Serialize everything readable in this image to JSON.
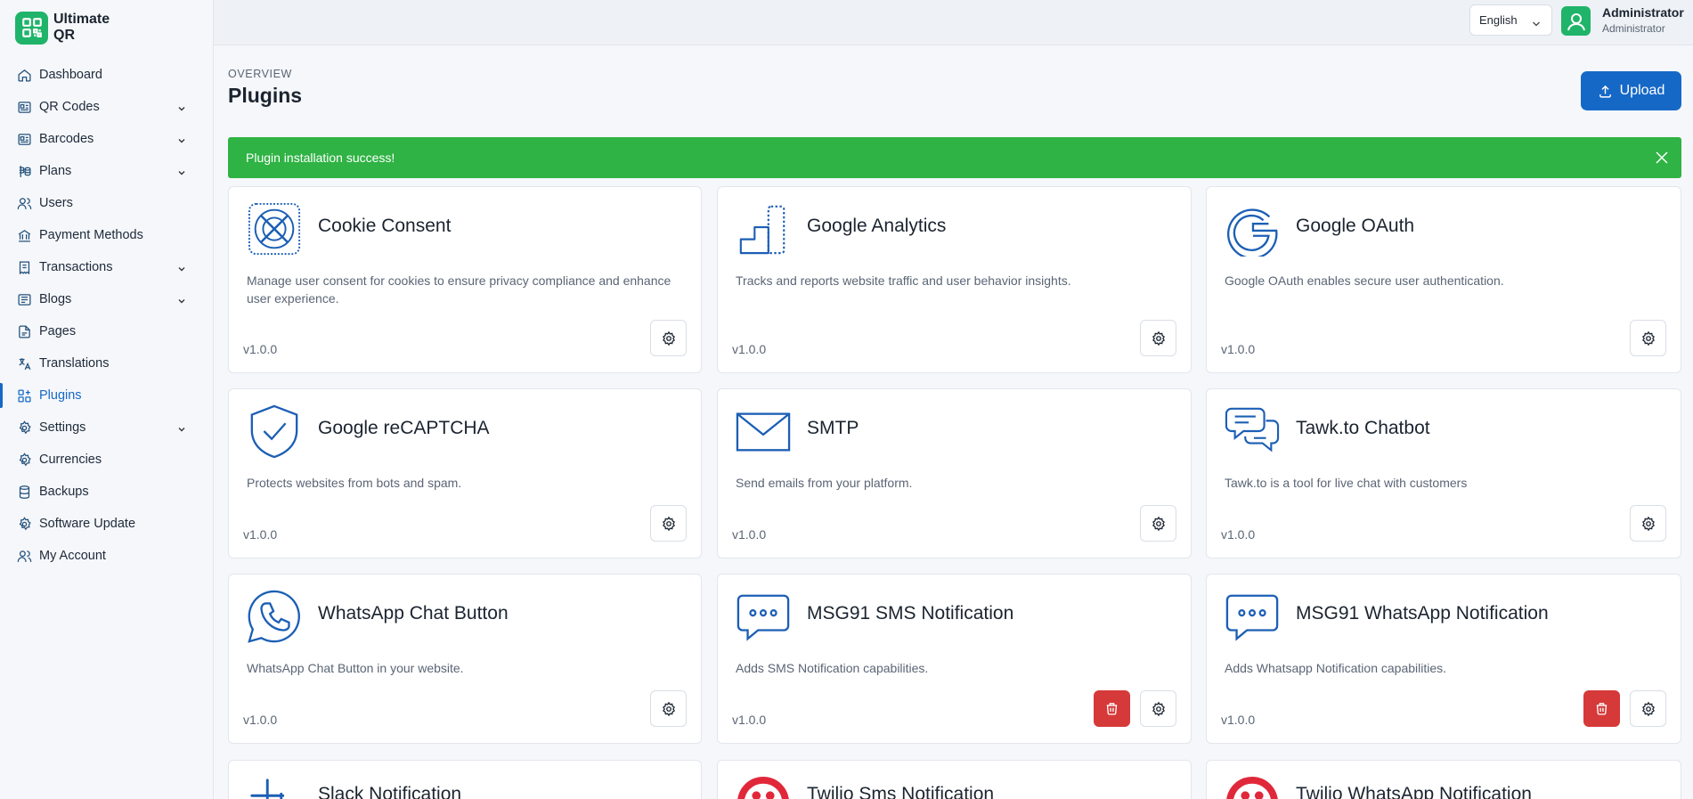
{
  "brand": {
    "name": "Ultimate QR"
  },
  "sidebar": {
    "items": [
      {
        "label": "Dashboard"
      },
      {
        "label": "QR Codes"
      },
      {
        "label": "Barcodes"
      },
      {
        "label": "Plans"
      },
      {
        "label": "Users"
      },
      {
        "label": "Payment Methods"
      },
      {
        "label": "Transactions"
      },
      {
        "label": "Blogs"
      },
      {
        "label": "Pages"
      },
      {
        "label": "Translations"
      },
      {
        "label": "Plugins"
      },
      {
        "label": "Settings"
      },
      {
        "label": "Currencies"
      },
      {
        "label": "Backups"
      },
      {
        "label": "Software Update"
      },
      {
        "label": "My Account"
      }
    ]
  },
  "topbar": {
    "language": "English",
    "user_name": "Administrator",
    "user_role": "Administrator"
  },
  "header": {
    "overline": "OVERVIEW",
    "title": "Plugins",
    "upload_label": "Upload"
  },
  "alert": {
    "message": "Plugin installation success!"
  },
  "plugins": [
    {
      "title": "Cookie Consent",
      "desc": "Manage user consent for cookies to ensure privacy compliance and enhance user experience.",
      "version": "v1.0.0"
    },
    {
      "title": "Google Analytics",
      "desc": "Tracks and reports website traffic and user behavior insights.",
      "version": "v1.0.0"
    },
    {
      "title": "Google OAuth",
      "desc": "Google OAuth enables secure user authentication.",
      "version": "v1.0.0"
    },
    {
      "title": "Google reCAPTCHA",
      "desc": "Protects websites from bots and spam.",
      "version": "v1.0.0"
    },
    {
      "title": "SMTP",
      "desc": "Send emails from your platform.",
      "version": "v1.0.0"
    },
    {
      "title": "Tawk.to Chatbot",
      "desc": "Tawk.to is a tool for live chat with customers",
      "version": "v1.0.0"
    },
    {
      "title": "WhatsApp Chat Button",
      "desc": "WhatsApp Chat Button in your website.",
      "version": "v1.0.0"
    },
    {
      "title": "MSG91 SMS Notification",
      "desc": "Adds SMS Notification capabilities.",
      "version": "v1.0.0"
    },
    {
      "title": "MSG91 WhatsApp Notification",
      "desc": "Adds Whatsapp Notification capabilities.",
      "version": "v1.0.0"
    },
    {
      "title": "Slack Notification"
    },
    {
      "title": "Twilio Sms Notification"
    },
    {
      "title": "Twilio WhatsApp Notification"
    }
  ],
  "colors": {
    "primary": "#1668c7",
    "success": "#2fb344",
    "danger": "#d63939",
    "brand": "#20b46a",
    "icon_blue": "#1c5fb5"
  }
}
